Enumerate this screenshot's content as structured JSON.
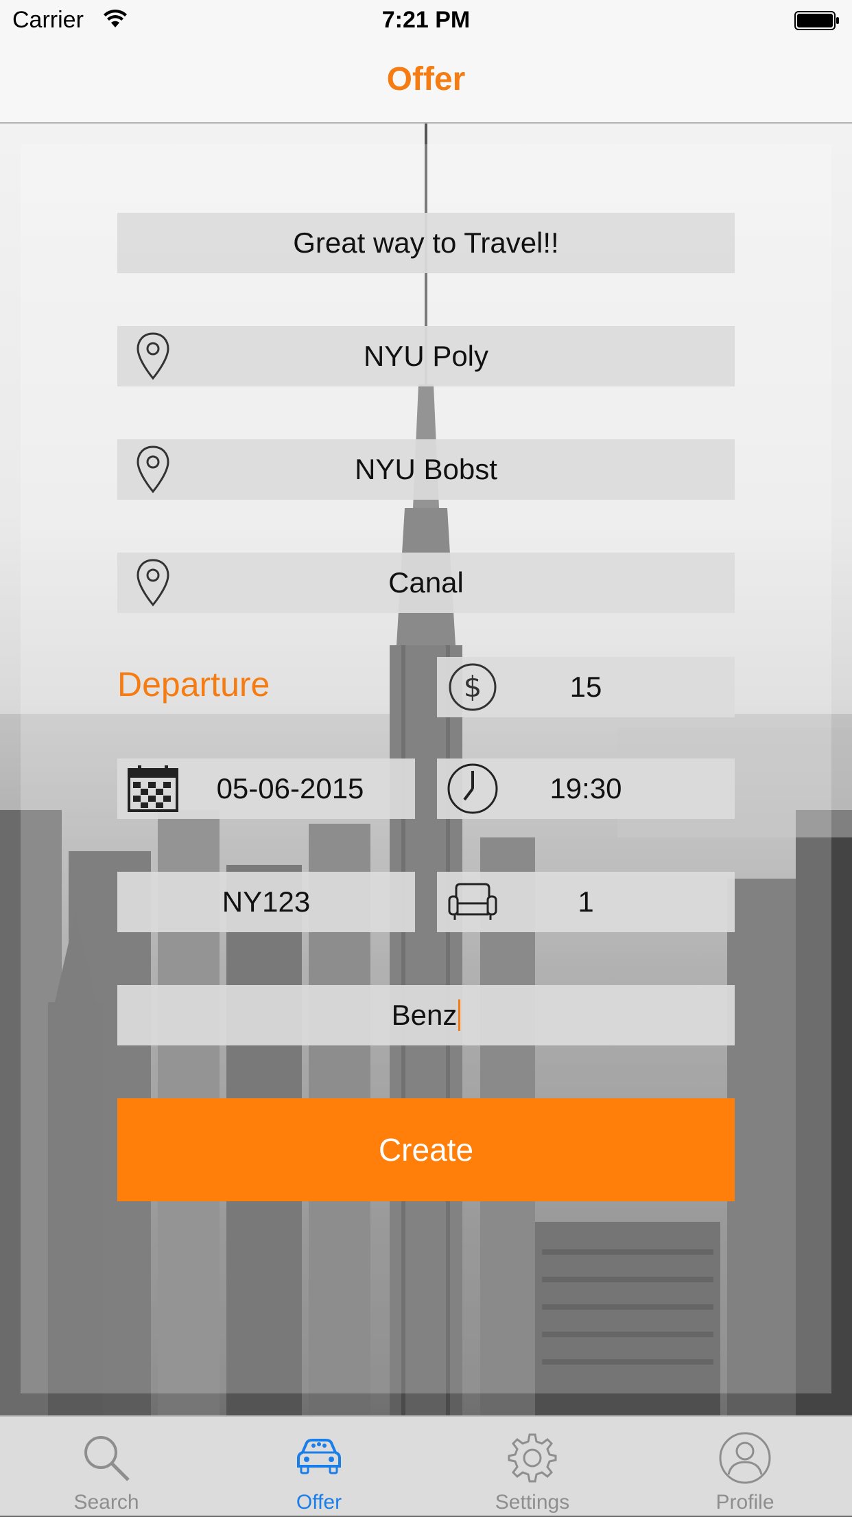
{
  "status_bar": {
    "carrier": "Carrier",
    "time": "7:21 PM"
  },
  "nav": {
    "title": "Offer"
  },
  "form": {
    "tagline": "Great way to Travel!!",
    "origin": "NYU Poly",
    "destination": "NYU Bobst",
    "stop": "Canal",
    "departure_label": "Departure",
    "price": "15",
    "date": "05-06-2015",
    "time": "19:30",
    "plate": "NY123",
    "seats": "1",
    "car": "Benz",
    "create_label": "Create"
  },
  "icons": {
    "location": "map-pin-icon",
    "price": "dollar-icon",
    "date": "calendar-icon",
    "time": "clock-icon",
    "seats": "armchair-icon"
  },
  "tabs": [
    {
      "label": "Search",
      "icon": "search-icon",
      "active": false
    },
    {
      "label": "Offer",
      "icon": "car-icon",
      "active": true
    },
    {
      "label": "Settings",
      "icon": "gear-icon",
      "active": false
    },
    {
      "label": "Profile",
      "icon": "person-icon",
      "active": false
    }
  ],
  "colors": {
    "accent": "#f47c12",
    "button": "#ff7f0a",
    "tab_active": "#1a7ee8",
    "tab_inactive": "#8e8e8e"
  }
}
